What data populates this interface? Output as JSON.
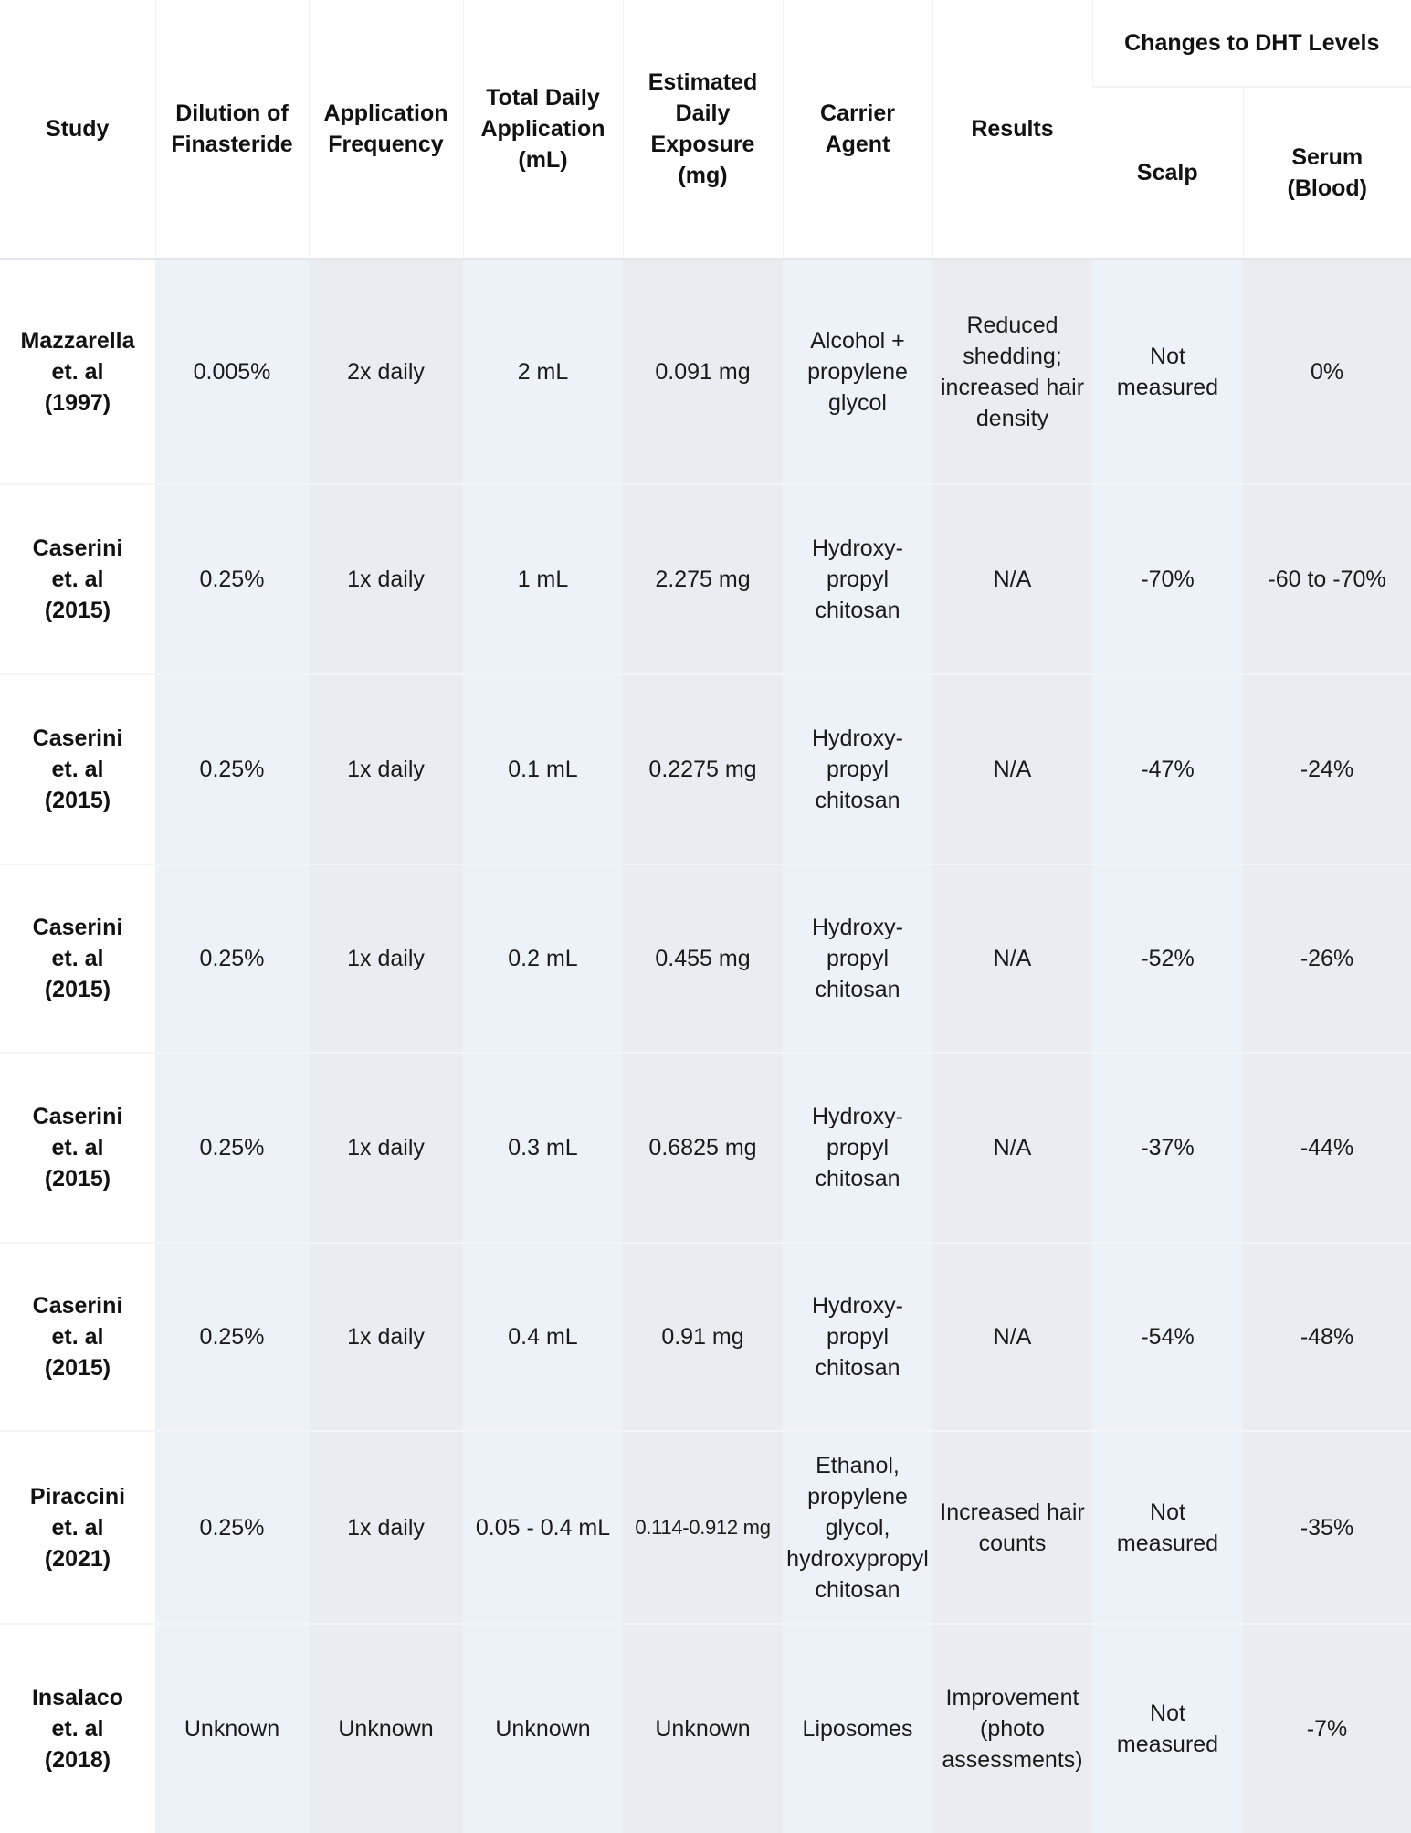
{
  "table": {
    "headers": {
      "study": "Study",
      "dilution": "Dilution of\nFinasteride",
      "frequency": "Application\nFrequency",
      "total_daily": "Total Daily\nApplication\n(mL)",
      "estimated_exposure": "Estimated\nDaily\nExposure\n(mg)",
      "carrier": "Carrier\nAgent",
      "results": "Results",
      "dht_group": "Changes to DHT Levels",
      "scalp": "Scalp",
      "serum": "Serum\n(Blood)"
    },
    "rows": [
      {
        "study": "Mazzarella\net. al\n(1997)",
        "dilution": "0.005%",
        "frequency": "2x daily",
        "total_daily": "2 mL",
        "exposure": "0.091 mg",
        "carrier": "Alcohol +\npropylene\nglycol",
        "results": "Reduced\nshedding;\nincreased hair\ndensity",
        "scalp": "Not\nmeasured",
        "serum": "0%"
      },
      {
        "study": "Caserini\net. al\n(2015)",
        "dilution": "0.25%",
        "frequency": "1x daily",
        "total_daily": "1 mL",
        "exposure": "2.275 mg",
        "carrier": "Hydroxy-\npropyl\nchitosan",
        "results": "N/A",
        "scalp": "-70%",
        "serum": "-60 to -70%"
      },
      {
        "study": "Caserini\net. al\n(2015)",
        "dilution": "0.25%",
        "frequency": "1x daily",
        "total_daily": "0.1 mL",
        "exposure": "0.2275 mg",
        "carrier": "Hydroxy-\npropyl\nchitosan",
        "results": "N/A",
        "scalp": "-47%",
        "serum": "-24%"
      },
      {
        "study": "Caserini\net. al\n(2015)",
        "dilution": "0.25%",
        "frequency": "1x daily",
        "total_daily": "0.2 mL",
        "exposure": "0.455 mg",
        "carrier": "Hydroxy-\npropyl\nchitosan",
        "results": "N/A",
        "scalp": "-52%",
        "serum": "-26%"
      },
      {
        "study": "Caserini\net. al\n(2015)",
        "dilution": "0.25%",
        "frequency": "1x daily",
        "total_daily": "0.3 mL",
        "exposure": "0.6825 mg",
        "carrier": "Hydroxy-\npropyl\nchitosan",
        "results": "N/A",
        "scalp": "-37%",
        "serum": "-44%"
      },
      {
        "study": "Caserini\net. al\n(2015)",
        "dilution": "0.25%",
        "frequency": "1x daily",
        "total_daily": "0.4 mL",
        "exposure": "0.91 mg",
        "carrier": "Hydroxy-\npropyl\nchitosan",
        "results": "N/A",
        "scalp": "-54%",
        "serum": "-48%"
      },
      {
        "study": "Piraccini\net. al\n(2021)",
        "dilution": "0.25%",
        "frequency": "1x daily",
        "total_daily": "0.05 - 0.4 mL",
        "exposure": "0.114-0.912 mg",
        "carrier": "Ethanol,\npropylene\nglycol,\nhydroxypropyl\nchitosan",
        "results": "Increased hair\ncounts",
        "scalp": "Not\nmeasured",
        "serum": "-35%"
      },
      {
        "study": "Insalaco\net. al\n(2018)",
        "dilution": "Unknown",
        "frequency": "Unknown",
        "total_daily": "Unknown",
        "exposure": "Unknown",
        "carrier": "Liposomes",
        "results": "Improvement\n(photo\nassessments)",
        "scalp": "Not\nmeasured",
        "serum": "-7%"
      }
    ]
  },
  "colors": {
    "column_blue": "#edf1f8",
    "column_gray": "#ebecf1",
    "header_bg": "#ffffff",
    "text": "#111111"
  }
}
